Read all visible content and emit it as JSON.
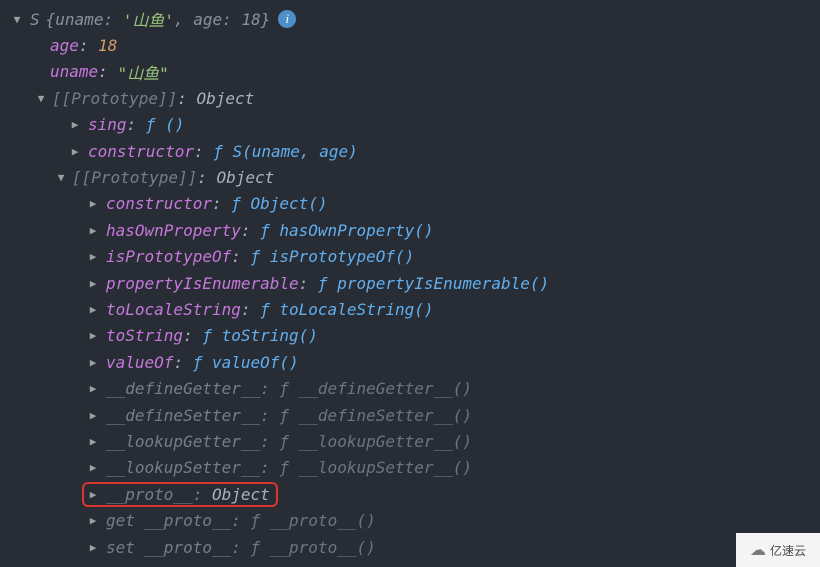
{
  "root": {
    "classLetter": "S",
    "brace_open": "{",
    "preview_uname_key": "uname",
    "preview_uname_val": "'山鱼'",
    "preview_age_key": "age",
    "preview_age_val": "18",
    "brace_close": "}"
  },
  "props": {
    "age_key": "age",
    "age_val": "18",
    "uname_key": "uname",
    "uname_val": "\"山鱼\""
  },
  "proto1": {
    "label": "[[Prototype]]",
    "value": "Object",
    "sing_key": "sing",
    "sing_fn": "ƒ ()",
    "constructor_key": "constructor",
    "constructor_fn": "ƒ S(uname, age)"
  },
  "proto2": {
    "label": "[[Prototype]]",
    "value": "Object",
    "items": [
      {
        "key": "constructor",
        "fn": "ƒ Object()",
        "dim": false
      },
      {
        "key": "hasOwnProperty",
        "fn": "ƒ hasOwnProperty()",
        "dim": false
      },
      {
        "key": "isPrototypeOf",
        "fn": "ƒ isPrototypeOf()",
        "dim": false
      },
      {
        "key": "propertyIsEnumerable",
        "fn": "ƒ propertyIsEnumerable()",
        "dim": false
      },
      {
        "key": "toLocaleString",
        "fn": "ƒ toLocaleString()",
        "dim": false
      },
      {
        "key": "toString",
        "fn": "ƒ toString()",
        "dim": false
      },
      {
        "key": "valueOf",
        "fn": "ƒ valueOf()",
        "dim": false
      },
      {
        "key": "__defineGetter__",
        "fn": "ƒ __defineGetter__()",
        "dim": true
      },
      {
        "key": "__defineSetter__",
        "fn": "ƒ __defineSetter__()",
        "dim": true
      },
      {
        "key": "__lookupGetter__",
        "fn": "ƒ __lookupGetter__()",
        "dim": true
      },
      {
        "key": "__lookupSetter__",
        "fn": "ƒ __lookupSetter__()",
        "dim": true
      }
    ],
    "proto_key": "__proto__",
    "proto_val": "Object",
    "get_key": "get __proto__",
    "get_fn": "ƒ __proto__()",
    "set_key": "set __proto__",
    "set_fn": "ƒ __proto__()"
  },
  "watermark": "亿速云"
}
